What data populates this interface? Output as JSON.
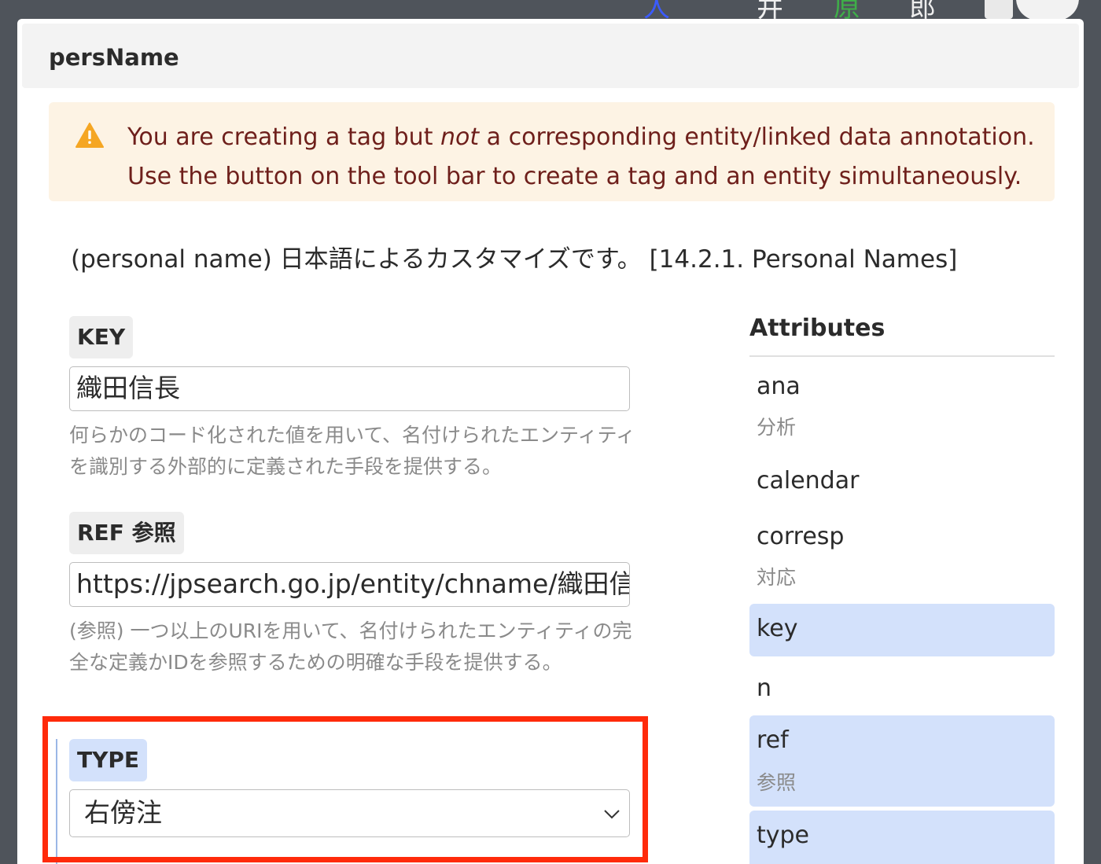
{
  "background": {
    "chars": [
      "人",
      "井",
      "原",
      "郎"
    ]
  },
  "dialog": {
    "title": "persName"
  },
  "warning": {
    "line1_before": "You are creating a tag but ",
    "line1_emph": "not",
    "line1_after": " a corresponding entity/linked data annotation.",
    "line2": "Use the button on the tool bar to create a tag and an entity simultaneously.",
    "icon": "warning-triangle-icon",
    "accent": "#f5a623"
  },
  "description": "(personal name) 日本語によるカスタマイズです。 [14.2.1. Personal Names]",
  "fields": {
    "key": {
      "label": "KEY",
      "value": "織田信長",
      "help": "何らかのコード化された値を用いて、名付けられたエンティティを識別する外部的に定義された手段を提供する。"
    },
    "ref": {
      "label": "REF 参照",
      "value": "https://jpsearch.go.jp/entity/chname/織田信長",
      "help": "(参照) 一つ以上のURIを用いて、名付けられたエンティティの完全な定義かIDを参照するための明確な手段を提供する。"
    },
    "type": {
      "label": "TYPE",
      "selected": "右傍注"
    }
  },
  "attributes": {
    "heading": "Attributes",
    "items": [
      {
        "name": "ana",
        "translation": "分析",
        "selected": false
      },
      {
        "name": "calendar",
        "translation": "",
        "selected": false
      },
      {
        "name": "corresp",
        "translation": "対応",
        "selected": false
      },
      {
        "name": "key",
        "translation": "",
        "selected": true
      },
      {
        "name": "n",
        "translation": "",
        "selected": false
      },
      {
        "name": "ref",
        "translation": "参照",
        "selected": true
      },
      {
        "name": "type",
        "translation": "",
        "selected": true
      }
    ]
  },
  "colors": {
    "highlight": "#ff2a0a",
    "selected_bg": "#d3e1fb",
    "warning_bg": "#fdf3e4",
    "warning_text": "#6e1f1b"
  }
}
